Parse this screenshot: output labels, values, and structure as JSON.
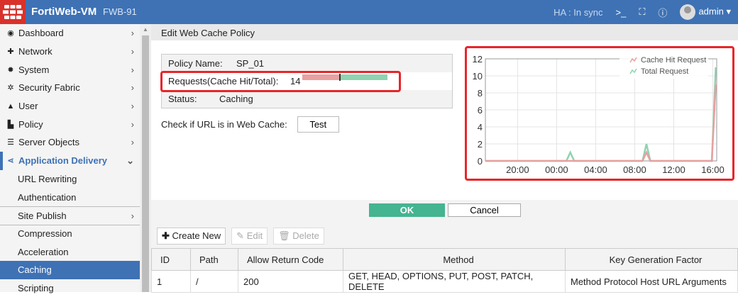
{
  "header": {
    "brand": "FortiWeb-VM",
    "hostname": "FWB-91",
    "ha_label": "HA :",
    "ha_status": "In sync",
    "user": "admin"
  },
  "sidebar": {
    "items": [
      {
        "label": "Dashboard",
        "icon": "dashboard-icon"
      },
      {
        "label": "Network",
        "icon": "network-icon"
      },
      {
        "label": "System",
        "icon": "gear-icon"
      },
      {
        "label": "Security Fabric",
        "icon": "fabric-icon"
      },
      {
        "label": "User",
        "icon": "user-icon"
      },
      {
        "label": "Policy",
        "icon": "policy-icon"
      },
      {
        "label": "Server Objects",
        "icon": "server-icon"
      },
      {
        "label": "Application Delivery",
        "icon": "app-delivery-icon"
      },
      {
        "label": "URL Rewriting"
      },
      {
        "label": "Authentication"
      },
      {
        "label": "Site Publish"
      },
      {
        "label": "Compression"
      },
      {
        "label": "Acceleration"
      },
      {
        "label": "Caching"
      },
      {
        "label": "Scripting"
      }
    ]
  },
  "page": {
    "title": "Edit Web Cache Policy",
    "policy_name_label": "Policy Name:",
    "policy_name": "SP_01",
    "requests_label": "Requests(Cache Hit/Total):",
    "requests_value": "14",
    "cache_hit_fraction": 0.43,
    "status_label": "Status:",
    "status": "Caching",
    "check_label": "Check if URL is in Web Cache:",
    "test_button": "Test",
    "ok": "OK",
    "cancel": "Cancel"
  },
  "toolbar": {
    "create": "Create New",
    "edit": "Edit",
    "delete": "Delete"
  },
  "table": {
    "headers": [
      "ID",
      "Path",
      "Allow Return Code",
      "Method",
      "Key Generation Factor"
    ],
    "rows": [
      [
        "1",
        "/",
        "200",
        "GET, HEAD, OPTIONS, PUT, POST, PATCH, DELETE",
        "Method Protocol Host URL Arguments"
      ]
    ]
  },
  "chart_data": {
    "type": "line",
    "title": "",
    "xlabel": "",
    "ylabel": "",
    "ylim": [
      0,
      12
    ],
    "yticks": [
      "0",
      "2",
      "4",
      "6",
      "8",
      "10",
      "12"
    ],
    "x_unit": "hours since 20:00",
    "xlim": [
      -3.3,
      20.4
    ],
    "xticks": [
      {
        "v": 0,
        "label": "20:00"
      },
      {
        "v": 4,
        "label": "00:00"
      },
      {
        "v": 8,
        "label": "04:00"
      },
      {
        "v": 12,
        "label": "08:00"
      },
      {
        "v": 16,
        "label": "12:00"
      },
      {
        "v": 20,
        "label": "16:00"
      }
    ],
    "legend": "top-right",
    "grid": true,
    "series": [
      {
        "name": "Cache Hit Request",
        "color": "#e8a0a0",
        "x": [
          -3.3,
          12.8,
          13.2,
          13.6,
          19.9,
          20.3
        ],
        "y": [
          0,
          0,
          1,
          0,
          0,
          9
        ]
      },
      {
        "name": "Total Request",
        "color": "#8fd3b1",
        "x": [
          -3.3,
          5.0,
          5.4,
          5.8,
          12.8,
          13.2,
          13.6,
          19.9,
          20.3
        ],
        "y": [
          0,
          0,
          1,
          0,
          0,
          2,
          0,
          0,
          11
        ]
      }
    ]
  }
}
